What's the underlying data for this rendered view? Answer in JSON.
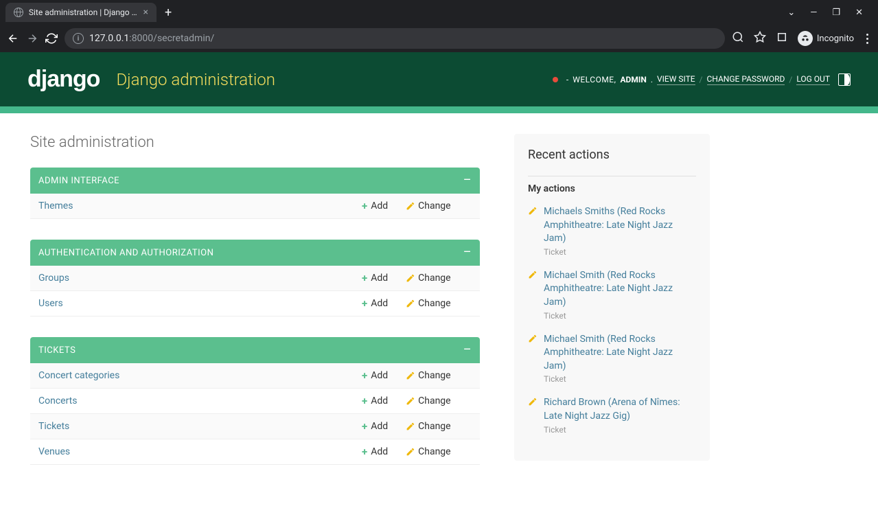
{
  "browser": {
    "tab_title": "Site administration | Django admin",
    "url_host": "127.0.0.1",
    "url_port": ":8000",
    "url_path": "/secretadmin/",
    "incognito_label": "Incognito"
  },
  "header": {
    "logo_text": "django",
    "site_title": "Django administration",
    "dash": "-",
    "welcome": "WELCOME,",
    "user": "ADMIN",
    "period": ".",
    "view_site": "VIEW SITE",
    "change_password": "CHANGE PASSWORD",
    "log_out": "LOG OUT",
    "sep": "/"
  },
  "page": {
    "title": "Site administration"
  },
  "apps": [
    {
      "name": "ADMIN INTERFACE",
      "models": [
        {
          "name": "Themes",
          "add": "Add",
          "change": "Change"
        }
      ]
    },
    {
      "name": "AUTHENTICATION AND AUTHORIZATION",
      "models": [
        {
          "name": "Groups",
          "add": "Add",
          "change": "Change"
        },
        {
          "name": "Users",
          "add": "Add",
          "change": "Change"
        }
      ]
    },
    {
      "name": "TICKETS",
      "models": [
        {
          "name": "Concert categories",
          "add": "Add",
          "change": "Change"
        },
        {
          "name": "Concerts",
          "add": "Add",
          "change": "Change"
        },
        {
          "name": "Tickets",
          "add": "Add",
          "change": "Change"
        },
        {
          "name": "Venues",
          "add": "Add",
          "change": "Change"
        }
      ]
    }
  ],
  "sidebar": {
    "title": "Recent actions",
    "my_actions": "My actions",
    "actions": [
      {
        "text": "Michaels Smiths (Red Rocks Amphitheatre: Late Night Jazz Jam)",
        "type": "Ticket"
      },
      {
        "text": "Michael Smith (Red Rocks Amphitheatre: Late Night Jazz Jam)",
        "type": "Ticket"
      },
      {
        "text": "Michael Smith (Red Rocks Amphitheatre: Late Night Jazz Jam)",
        "type": "Ticket"
      },
      {
        "text": "Richard Brown (Arena of Nîmes: Late Night Jazz Gig)",
        "type": "Ticket"
      }
    ]
  }
}
